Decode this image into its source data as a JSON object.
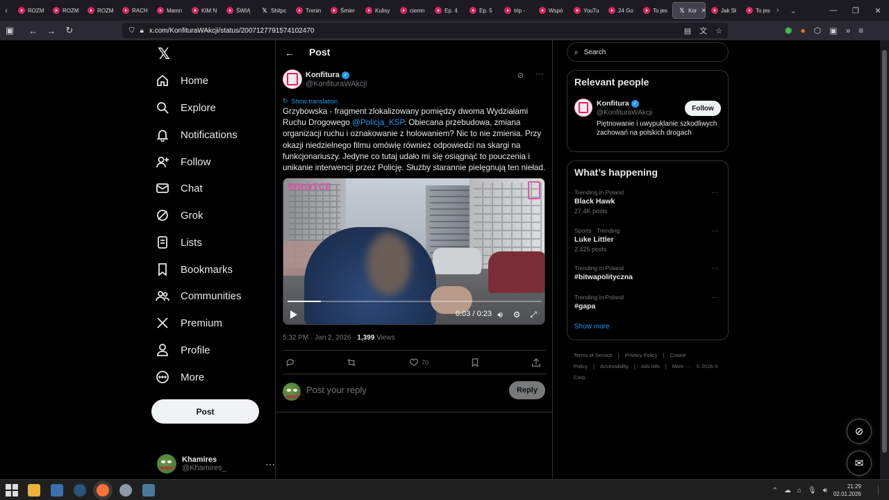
{
  "browser": {
    "tabs": [
      {
        "label": "ROZM",
        "icon": "youtube-icon"
      },
      {
        "label": "ROZM",
        "icon": "youtube-icon"
      },
      {
        "label": "ROZM",
        "icon": "youtube-icon"
      },
      {
        "label": "RACH",
        "icon": "youtube-icon"
      },
      {
        "label": "Mamn",
        "icon": "youtube-icon"
      },
      {
        "label": "KIM N",
        "icon": "youtube-icon"
      },
      {
        "label": "ŚWIĄ",
        "icon": "youtube-icon"
      },
      {
        "label": "Shitpc",
        "icon": "x-icon"
      },
      {
        "label": "Trenin",
        "icon": "youtube-icon"
      },
      {
        "label": "Śmier",
        "icon": "youtube-icon"
      },
      {
        "label": "Kulisy",
        "icon": "youtube-icon"
      },
      {
        "label": "ciemn",
        "icon": "youtube-icon"
      },
      {
        "label": "Ep. 4",
        "icon": "youtube-icon"
      },
      {
        "label": "Ep. 5",
        "icon": "youtube-icon"
      },
      {
        "label": "trip - ",
        "icon": "youtube-icon"
      },
      {
        "label": "Wspó",
        "icon": "youtube-icon"
      },
      {
        "label": "YouTu",
        "icon": "youtube-icon"
      },
      {
        "label": "24 Go",
        "icon": "youtube-icon"
      },
      {
        "label": "To jes",
        "icon": "youtube-icon"
      },
      {
        "label": "Kor",
        "icon": "x-icon",
        "active": true
      },
      {
        "label": "Jak Sł",
        "icon": "youtube-icon"
      },
      {
        "label": "To jes",
        "icon": "youtube-icon"
      }
    ],
    "url": "x.com/KonfituraWAkcji/status/2007127791574102470"
  },
  "nav": {
    "items": [
      {
        "label": "Home",
        "icon": "home-icon"
      },
      {
        "label": "Explore",
        "icon": "search-icon"
      },
      {
        "label": "Notifications",
        "icon": "bell-icon"
      },
      {
        "label": "Follow",
        "icon": "follow-icon"
      },
      {
        "label": "Chat",
        "icon": "mail-icon"
      },
      {
        "label": "Grok",
        "icon": "grok-icon"
      },
      {
        "label": "Lists",
        "icon": "list-icon"
      },
      {
        "label": "Bookmarks",
        "icon": "bookmark-icon"
      },
      {
        "label": "Communities",
        "icon": "communities-icon"
      },
      {
        "label": "Premium",
        "icon": "x-icon"
      },
      {
        "label": "Profile",
        "icon": "profile-icon"
      },
      {
        "label": "More",
        "icon": "more-circle-icon"
      }
    ],
    "post_label": "Post",
    "account": {
      "name": "Khamires",
      "handle": "@Khamires_"
    }
  },
  "post": {
    "header_title": "Post",
    "author": {
      "name": "Konfitura",
      "handle": "@KonfituraWAkcji"
    },
    "show_translation": "Show translation",
    "text_before_mention": "Grzybowska - fragment zlokalizowany pomiędzy dwoma Wydziałami Ruchu Drogowego ",
    "mention": "@Policja_KSP",
    "text_after_mention": ". Obiecana przebudowa, zmiana organizacji ruchu i oznakowanie z holowaniem? Nic to nie zmienia. Przy okazji niedzielnego filmu omówię również odpowiedzi na skargi na funkcjonariuszy. Jedyne co tutaj udało mi się osiągnąć to pouczenia i unikanie interwencji przez Policję. Służby starannie pielęgnują ten nieład.",
    "video": {
      "watermark": "WRÓTCE",
      "time": "0:03 / 0:23",
      "progress": 0.13
    },
    "time": "5:32 PM · Jan 2, 2026 · ",
    "views_count": "1,399",
    "views_label": " Views",
    "likes": "70",
    "reply_placeholder": "Post your reply",
    "reply_button": "Reply"
  },
  "sidebar": {
    "search_placeholder": "Search",
    "relevant": {
      "title": "Relevant people",
      "name": "Konfitura",
      "handle": "@KonfituraWAkcji",
      "bio": "Piętnowanie i uwypuklanie szkodliwych zachowań na polskich drogach",
      "follow": "Follow"
    },
    "happening": {
      "title": "What’s happening",
      "trends": [
        {
          "context": "Trending in Poland",
          "name": "Black Hawk",
          "posts": "27.4K posts"
        },
        {
          "context": "Sports · Trending",
          "name": "Luke Littler",
          "posts": "2,425 posts"
        },
        {
          "context": "Trending in Poland",
          "name": "#bitwapolityczna",
          "posts": ""
        },
        {
          "context": "Trending in Poland",
          "name": "#gapa",
          "posts": ""
        }
      ],
      "show_more": "Show more"
    },
    "footer": [
      "Terms of Service",
      "|",
      "Privacy Policy",
      "|",
      "Cookie Policy",
      "|",
      "Accessibility",
      "|",
      "Ads info",
      "|",
      "More ···",
      "© 2026 X Corp."
    ]
  },
  "taskbar": {
    "time": "21:29",
    "date": "02.01.2026"
  },
  "colors": {
    "accent": "#1d9bf0",
    "background": "#000000",
    "border": "#2f3336",
    "muted": "#71767b"
  }
}
